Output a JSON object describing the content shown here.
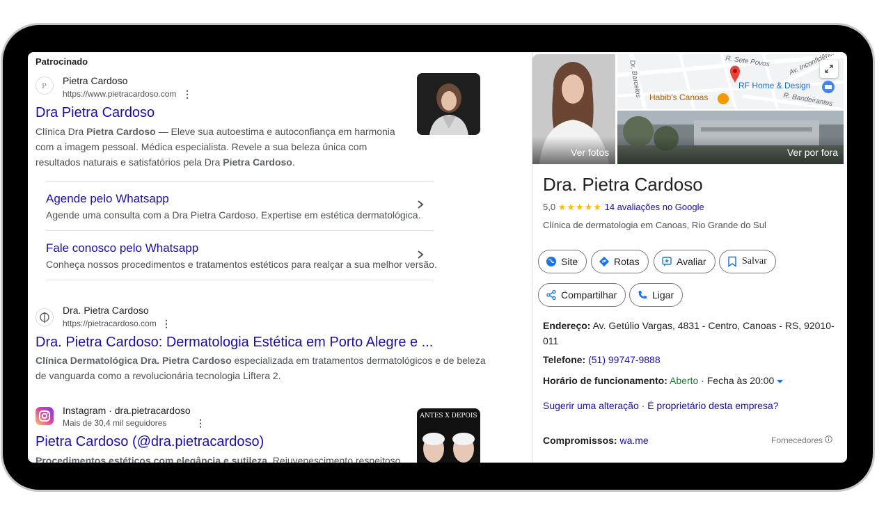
{
  "sponsored_label": "Patrocinado",
  "ad": {
    "site_name": "Pietra Cardoso",
    "url": "https://www.pietracardoso.com",
    "menu": "⋮",
    "title": "Dra Pietra Cardoso",
    "snippet_1_pre": "Clínica Dra ",
    "snippet_1_bold": "Pietra Cardoso",
    "snippet_1_post": " — Eleve sua autoestima e autoconfiança em harmonia",
    "snippet_2": "com a imagem pessoal. Médica especialista. Revele a sua beleza única com",
    "snippet_3_pre": "resultados naturais e satisfatórios pela Dra ",
    "snippet_3_bold": "Pietra Cardoso",
    "snippet_3_post": ".",
    "sitelinks": [
      {
        "title": "Agende pelo Whatsapp",
        "desc": "Agende uma consulta com a Dra Pietra Cardoso. Expertise em estética dermatológica."
      },
      {
        "title": "Fale conosco pelo Whatsapp",
        "desc": "Conheça nossos procedimentos e tratamentos estéticos para realçar a sua melhor versão."
      }
    ]
  },
  "result2": {
    "site_name": "Dra. Pietra Cardoso",
    "url": "https://pietracardoso.com",
    "menu": "⋮",
    "title": "Dra. Pietra Cardoso: Dermatologia Estética em Porto Alegre e ...",
    "snippet_1_bold": "Clínica Dermatológica Dra. Pietra Cardoso",
    "snippet_1_post": " especializada em tratamentos dermatológicos e de beleza",
    "snippet_2": "de vanguarda como a revolucionária tecnologia Liftera 2."
  },
  "result3": {
    "site_name": "Instagram · dra.pietracardoso",
    "followers": "Mais de 30,4 mil seguidores",
    "menu": "⋮",
    "title": "Pietra Cardoso (@dra.pietracardoso)",
    "snippet_bold": "Procedimentos estéticos com elegância e sutileza",
    "snippet_post": ". Rejuvenescimento respeitoso.",
    "thumb_caption": "ANTES X DEPOIS"
  },
  "panel": {
    "photo_label": "Ver fotos",
    "exterior_label": "Ver por fora",
    "map_labels": {
      "street1": "R. Sete Povos",
      "street2": "Av. Inconfidência",
      "street3": "Dr. Barcelos",
      "place1": "Habib's Canoas",
      "place2": "RF Home & Design",
      "street4": "R. Bandeirantes"
    },
    "title": "Dra. Pietra Cardoso",
    "rating_value": "5,0",
    "stars": "★★★★★",
    "reviews_link": "14 avaliações no Google",
    "category": "Clínica de dermatologia em Canoas, Rio Grande do Sul",
    "buttons": {
      "site": "Site",
      "rotas": "Rotas",
      "avaliar": "Avaliar",
      "salvar": "Salvar",
      "compartilhar": "Compartilhar",
      "ligar": "Ligar"
    },
    "address_label": "Endereço:",
    "address_value": "Av. Getúlio Vargas, 4831 - Centro, Canoas - RS, 92010-",
    "address_value_2": "011",
    "phone_label": "Telefone:",
    "phone_value": "(51) 99747-9888",
    "hours_label": "Horário de funcionamento:",
    "hours_status": "Aberto",
    "hours_sep": " · ",
    "hours_close": "Fecha às 20:00",
    "suggest_edit": "Sugerir uma alteração",
    "link_sep": " · ",
    "owner_link": "É proprietário desta empresa?",
    "appointments_label": "Compromissos:",
    "appointments_value": "wa.me",
    "suppliers": "Fornecedores"
  }
}
